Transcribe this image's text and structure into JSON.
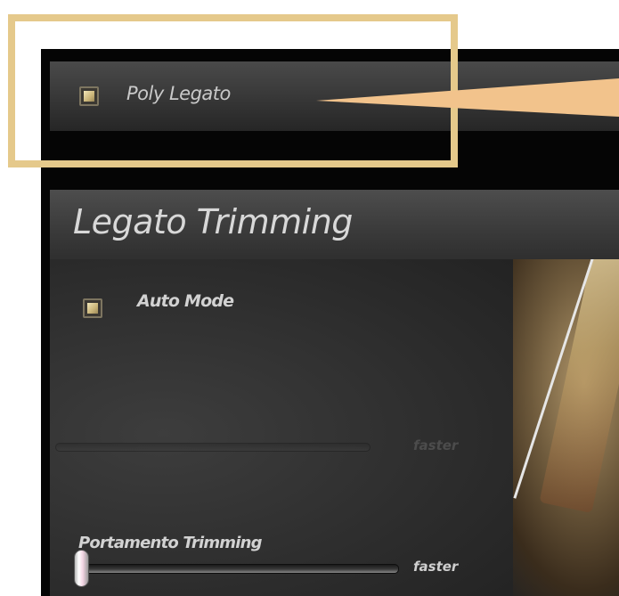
{
  "poly_legato": {
    "label": "Poly Legato",
    "checked": true
  },
  "legato_trimming": {
    "title": "Legato Trimming",
    "auto_mode": {
      "label": "Auto Mode",
      "checked": true
    },
    "legato_slider": {
      "right_label": "faster"
    }
  },
  "portamento_trimming": {
    "label": "Portamento Trimming",
    "slider": {
      "right_label": "faster",
      "value": 0
    }
  },
  "colors": {
    "callout": "#e5c98b",
    "checkbox_fill": "#c9b478",
    "panel_bg": "#050505"
  },
  "icons": {
    "callout_arrow": "arrow-pointer-icon"
  }
}
